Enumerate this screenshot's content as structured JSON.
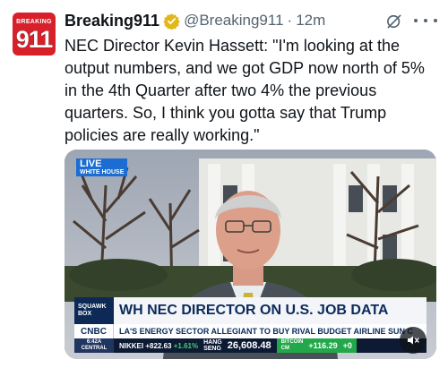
{
  "tweet": {
    "avatar": {
      "top_text": "BREAKING",
      "number": "911",
      "color": "#d8202a"
    },
    "display_name": "Breaking911",
    "verified_icon": "gold-verified-badge-icon",
    "handle": "@Breaking911",
    "separator": "·",
    "time": "12m",
    "grok_icon": "grok-icon",
    "more_icon": "more-options-icon",
    "text": "NEC Director Kevin Hassett: \"I'm looking at the output numbers, and we got GDP now north of 5% in the 4th Quarter after two 4% the previous quarters. So, I think you gotta say that Trump policies are really working.\""
  },
  "video": {
    "live_label": "LIVE",
    "location_label": "WHITE HOUSE",
    "show_label": "SQUAWK BOX",
    "headline": "WH NEC DIRECTOR ON U.S. JOB DATA",
    "network": "CNBC",
    "ticker_line": "LA'S ENERGY SECTOR     ALLEGIANT TO BUY RIVAL BUDGET AIRLINE SUN C",
    "clock_time": "6:42A",
    "clock_zone": "CENTRAL",
    "nikkei_label": "NIKKEI",
    "nikkei_change": "+822.63",
    "nikkei_pct": "+1.61%",
    "hang_label_1": "HANG",
    "hang_label_2": "SENG",
    "hang_value": "26,608.48",
    "bitcoin_label_1": "BITCOIN",
    "bitcoin_label_2": "CM",
    "bitcoin_change": "+116.29",
    "bitcoin_pct": "+0",
    "mute_icon": "muted-speaker-icon",
    "live_color": "#1b6dd1",
    "headline_color": "#0b2a5c"
  }
}
